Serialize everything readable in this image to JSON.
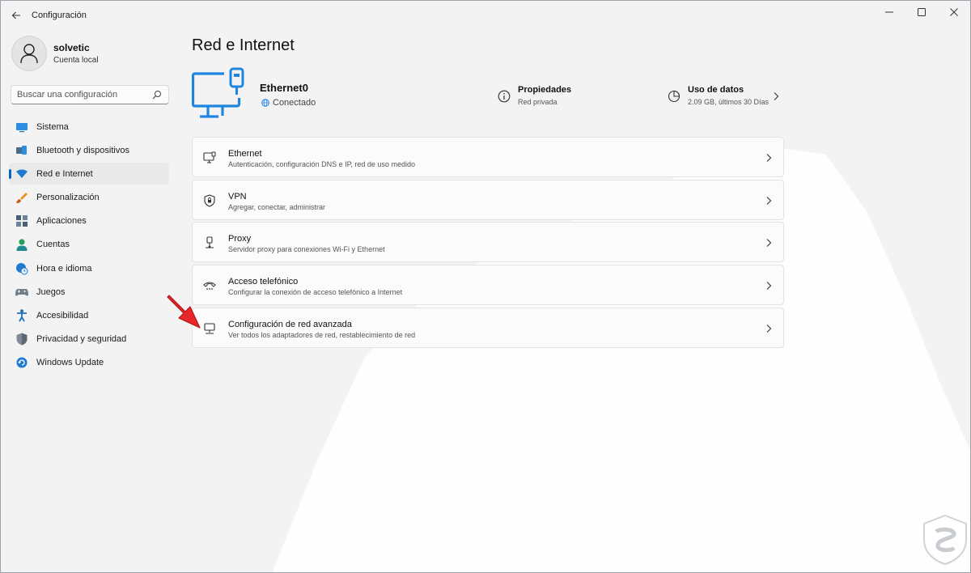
{
  "window": {
    "title": "Configuración"
  },
  "profile": {
    "name": "solvetic",
    "account_type": "Cuenta local"
  },
  "search": {
    "placeholder": "Buscar una configuración"
  },
  "sidebar": {
    "items": [
      {
        "label": "Sistema",
        "icon": "system-icon"
      },
      {
        "label": "Bluetooth y dispositivos",
        "icon": "bluetooth-icon"
      },
      {
        "label": "Red e Internet",
        "icon": "wifi-icon",
        "active": true
      },
      {
        "label": "Personalización",
        "icon": "brush-icon"
      },
      {
        "label": "Aplicaciones",
        "icon": "apps-icon"
      },
      {
        "label": "Cuentas",
        "icon": "person-icon"
      },
      {
        "label": "Hora e idioma",
        "icon": "globe-clock-icon"
      },
      {
        "label": "Juegos",
        "icon": "gamepad-icon"
      },
      {
        "label": "Accesibilidad",
        "icon": "accessibility-icon"
      },
      {
        "label": "Privacidad y seguridad",
        "icon": "shield-icon"
      },
      {
        "label": "Windows Update",
        "icon": "update-icon"
      }
    ]
  },
  "page": {
    "title": "Red e Internet"
  },
  "hero": {
    "adapter_name": "Ethernet0",
    "status": "Conectado",
    "properties_title": "Propiedades",
    "properties_sub": "Red privada",
    "usage_title": "Uso de datos",
    "usage_sub": "2.09 GB, últimos 30 Días"
  },
  "cards": [
    {
      "title": "Ethernet",
      "subtitle": "Autenticación, configuración DNS e IP, red de uso medido",
      "icon": "ethernet-icon"
    },
    {
      "title": "VPN",
      "subtitle": "Agregar, conectar, administrar",
      "icon": "vpn-shield-icon"
    },
    {
      "title": "Proxy",
      "subtitle": "Servidor proxy para conexiones Wi-Fi y Ethernet",
      "icon": "proxy-icon"
    },
    {
      "title": "Acceso telefónico",
      "subtitle": "Configurar la conexión de acceso telefónico a Internet",
      "icon": "dialup-icon"
    },
    {
      "title": "Configuración de red avanzada",
      "subtitle": "Ver todos los adaptadores de red, restablecimiento de red",
      "icon": "network-adapter-icon"
    }
  ],
  "colors": {
    "accent": "#0067c0",
    "arrow": "#e8262b",
    "window_bg": "#f3f3f3"
  }
}
